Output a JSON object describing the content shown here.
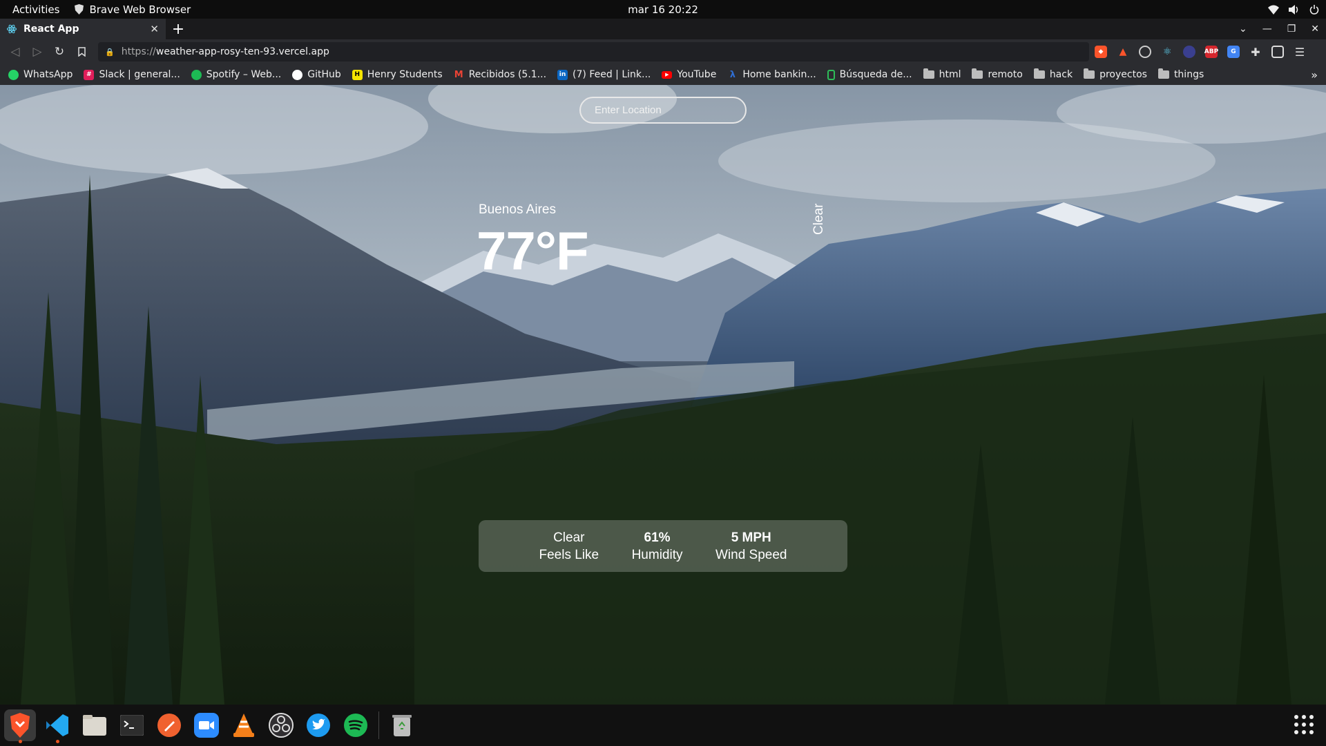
{
  "system": {
    "activities": "Activities",
    "app_name": "Brave Web Browser",
    "clock": "mar 16  20:22"
  },
  "browser": {
    "tab": {
      "title": "React App"
    },
    "url": {
      "scheme": "https://",
      "host": "weather-app-rosy-ten-93.vercel.app"
    },
    "bookmarks": [
      {
        "label": "WhatsApp",
        "icon": "whatsapp-icon",
        "color": "#25d366"
      },
      {
        "label": "Slack | general...",
        "icon": "slack-icon",
        "color": "#e01e5a"
      },
      {
        "label": "Spotify – Web...",
        "icon": "spotify-icon",
        "color": "#1db954"
      },
      {
        "label": "GitHub",
        "icon": "github-icon",
        "color": "#ffffff"
      },
      {
        "label": "Henry Students",
        "icon": "henry-icon",
        "color": "#f5e400"
      },
      {
        "label": "Recibidos (5.1...",
        "icon": "gmail-icon",
        "color": "#ea4335"
      },
      {
        "label": "(7) Feed | Link...",
        "icon": "linkedin-icon",
        "color": "#0a66c2"
      },
      {
        "label": "YouTube",
        "icon": "youtube-icon",
        "color": "#ff0000"
      },
      {
        "label": "Home bankin...",
        "icon": "bank-icon",
        "color": "#2f6fd6"
      },
      {
        "label": "Búsqueda de...",
        "icon": "search-doc-icon",
        "color": "#2ebd59"
      },
      {
        "label": "html",
        "icon": "folder-icon",
        "color": "#bdbdbd"
      },
      {
        "label": "remoto",
        "icon": "folder-icon",
        "color": "#bdbdbd"
      },
      {
        "label": "hack",
        "icon": "folder-icon",
        "color": "#bdbdbd"
      },
      {
        "label": "proyectos",
        "icon": "folder-icon",
        "color": "#bdbdbd"
      },
      {
        "label": "things",
        "icon": "folder-icon",
        "color": "#bdbdbd"
      }
    ],
    "more": "»"
  },
  "weather": {
    "search_placeholder": "Enter Location",
    "city": "Buenos Aires",
    "temperature": "77°F",
    "description": "Clear",
    "feels_like_value": "Clear",
    "feels_like_label": "Feels Like",
    "humidity_value": "61%",
    "humidity_label": "Humidity",
    "wind_value": "5 MPH",
    "wind_label": "Wind Speed"
  },
  "dock": {
    "apps": [
      {
        "name": "brave-icon",
        "color": "#fb542b",
        "active": true
      },
      {
        "name": "vscode-icon",
        "color": "#23a9f2",
        "running": true
      },
      {
        "name": "files-icon",
        "color": "#dcd8cf"
      },
      {
        "name": "terminal-icon",
        "color": "#2d2d2d"
      },
      {
        "name": "pencil-icon",
        "color": "#f0612f"
      },
      {
        "name": "zoom-icon",
        "color": "#2d8cff"
      },
      {
        "name": "vlc-icon",
        "color": "#f47f1a"
      },
      {
        "name": "obs-icon",
        "color": "#302e31"
      },
      {
        "name": "twitter-icon",
        "color": "#1d9bf0"
      },
      {
        "name": "spotify-icon",
        "color": "#1db954"
      },
      {
        "name": "trash-icon",
        "color": "#bfbfbf"
      }
    ]
  }
}
